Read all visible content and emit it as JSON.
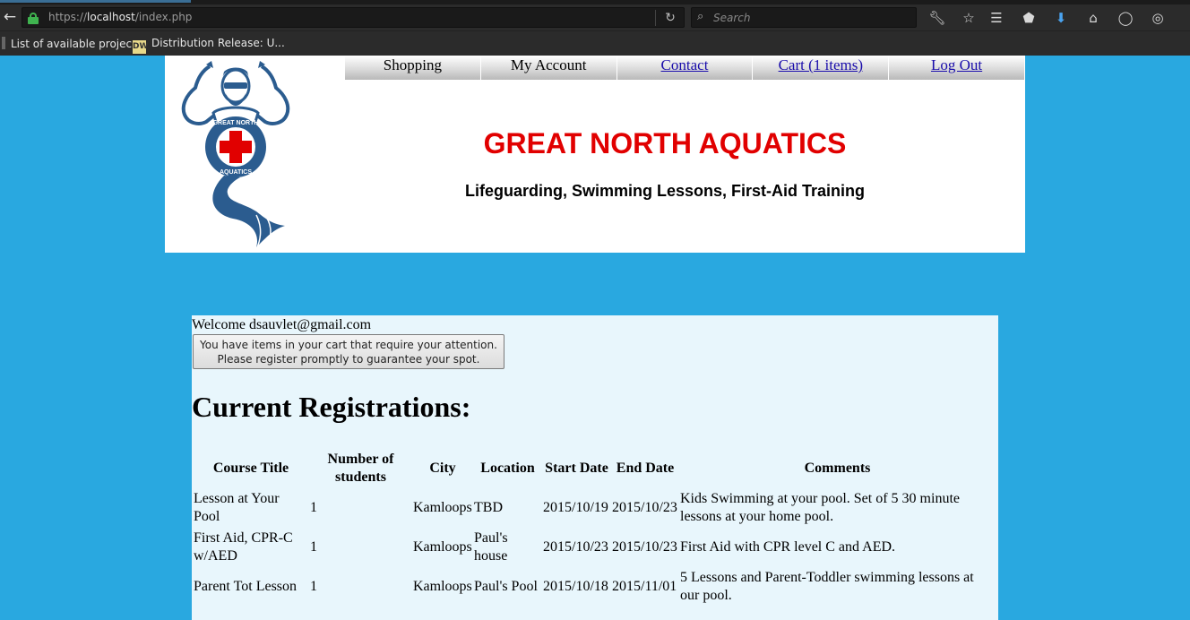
{
  "browser": {
    "url_prefix": "https://",
    "url_host": "localhost",
    "url_path": "/index.php",
    "search_placeholder": "Search",
    "bookmarks": [
      {
        "label": "List of available projec..."
      },
      {
        "label": "Distribution Release: U..."
      }
    ],
    "favicon_text": "DW"
  },
  "nav": {
    "items": [
      {
        "label": "Shopping"
      },
      {
        "label": "My Account"
      },
      {
        "label": "Contact"
      },
      {
        "label": "Cart (1 items)"
      },
      {
        "label": "Log Out"
      }
    ]
  },
  "header": {
    "title": "GREAT NORTH AQUATICS",
    "tagline": "Lifeguarding, Swimming Lessons, First-Aid Training",
    "logo_text_top": "GREAT NORTH",
    "logo_text_bottom": "AQUATICS"
  },
  "main": {
    "welcome": "Welcome dsauvlet@gmail.com",
    "alert_line1": "You have items in your cart that require your attention.",
    "alert_line2": "Please register promptly to guarantee your spot.",
    "section_title": "Current Registrations:",
    "table": {
      "headers": [
        "Course Title",
        "Number of students",
        "City",
        "Location",
        "Start Date",
        "End Date",
        "Comments"
      ],
      "rows": [
        [
          "Lesson at Your Pool",
          "1",
          "Kamloops",
          "TBD",
          "2015/10/19",
          "2015/10/23",
          "Kids Swimming at your pool. Set of 5 30 minute lessons at your home pool."
        ],
        [
          "First Aid, CPR-C w/AED",
          "1",
          "Kamloops",
          "Paul's house",
          "2015/10/23",
          "2015/10/23",
          "First Aid with CPR level C and AED."
        ],
        [
          "Parent Tot Lesson",
          "1",
          "Kamloops",
          "Paul's Pool",
          "2015/10/18",
          "2015/11/01",
          "5 Lessons and Parent-Toddler swimming lessons at our pool."
        ]
      ]
    }
  },
  "colors": {
    "page_background": "#29a8e0",
    "title_red": "#e10000",
    "panel_background": "#e8f6fc",
    "logo_blue": "#2b5c8f"
  }
}
